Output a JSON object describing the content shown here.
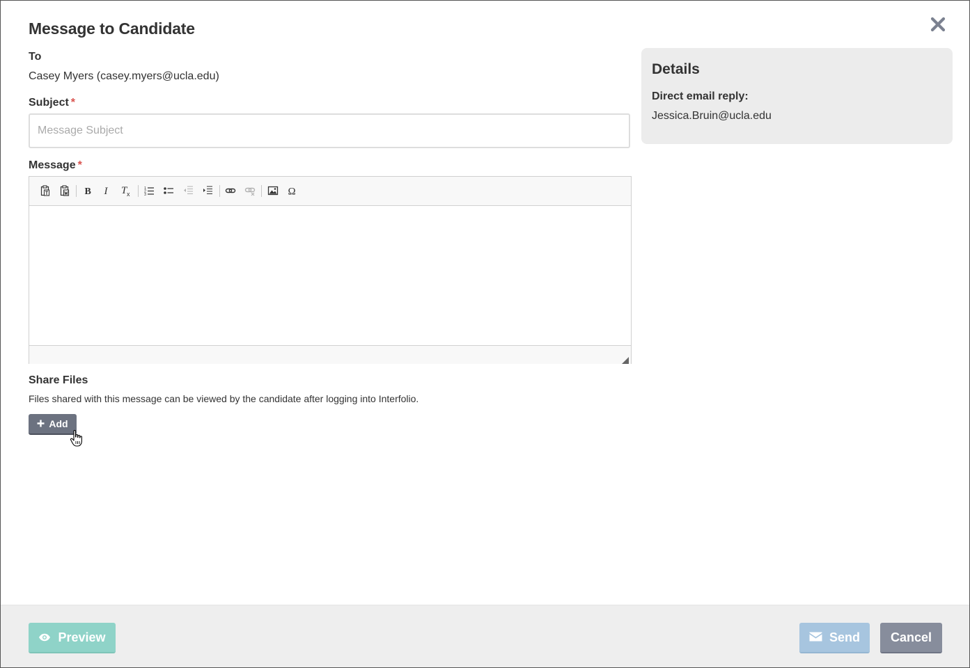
{
  "dialog": {
    "title": "Message to Candidate"
  },
  "to": {
    "label": "To",
    "value": "Casey Myers (casey.myers@ucla.edu)"
  },
  "subject": {
    "label": "Subject",
    "required_mark": "*",
    "placeholder": "Message Subject",
    "value": ""
  },
  "message": {
    "label": "Message",
    "required_mark": "*",
    "toolbar": [
      {
        "icon": "paste-text-icon",
        "enabled": true
      },
      {
        "icon": "paste-from-word-icon",
        "enabled": true
      },
      {
        "icon": "bold-icon",
        "enabled": true
      },
      {
        "icon": "italic-icon",
        "enabled": true
      },
      {
        "icon": "remove-format-icon",
        "enabled": true
      },
      {
        "icon": "numbered-list-icon",
        "enabled": true
      },
      {
        "icon": "bulleted-list-icon",
        "enabled": true
      },
      {
        "icon": "outdent-icon",
        "enabled": false
      },
      {
        "icon": "indent-icon",
        "enabled": true
      },
      {
        "icon": "link-icon",
        "enabled": true
      },
      {
        "icon": "unlink-icon",
        "enabled": false
      },
      {
        "icon": "image-icon",
        "enabled": true
      },
      {
        "icon": "special-character-icon",
        "enabled": true
      }
    ],
    "body": ""
  },
  "share_files": {
    "label": "Share Files",
    "description": "Files shared with this message can be viewed by the candidate after logging into Interfolio.",
    "add_label": "Add"
  },
  "details": {
    "title": "Details",
    "reply_label": "Direct email reply:",
    "reply_value": "Jessica.Bruin@ucla.edu"
  },
  "footer": {
    "preview_label": "Preview",
    "send_label": "Send",
    "cancel_label": "Cancel"
  },
  "colors": {
    "preview_button": "#8fd3c8",
    "send_button": "#a7c5df",
    "cancel_button": "#878d9c",
    "add_button": "#6c7280",
    "required_mark": "#d9534f",
    "details_background": "#ececec",
    "footer_background": "#eeeeee"
  }
}
